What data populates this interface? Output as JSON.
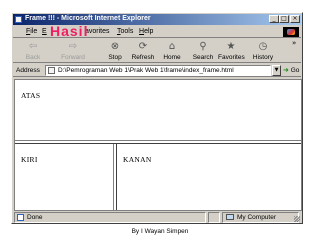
{
  "window": {
    "title": "Frame !!! - Microsoft Internet Explorer",
    "controls": {
      "minimize": "_",
      "maximize": "□",
      "close": "×"
    }
  },
  "watermark": "Hasil",
  "menu": {
    "file": "F",
    "file_rest": "ile",
    "edit": "E",
    "favorites": "avorites",
    "tools": "T",
    "tools_rest": "ools",
    "help": "H",
    "help_rest": "elp"
  },
  "toolbar": {
    "back": {
      "label": "Back",
      "icon": "arrow-left-icon",
      "glyph": "⇦"
    },
    "forward": {
      "label": "Forward",
      "icon": "arrow-right-icon",
      "glyph": "⇨"
    },
    "stop": {
      "label": "Stop",
      "icon": "stop-icon",
      "glyph": "⊗"
    },
    "refresh": {
      "label": "Refresh",
      "icon": "refresh-icon",
      "glyph": "⟳"
    },
    "home": {
      "label": "Home",
      "icon": "home-icon",
      "glyph": "⌂"
    },
    "search": {
      "label": "Search",
      "icon": "search-icon",
      "glyph": "⚲"
    },
    "favorites": {
      "label": "Favorites",
      "icon": "favorites-icon",
      "glyph": "★"
    },
    "history": {
      "label": "History",
      "icon": "history-icon",
      "glyph": "◷"
    },
    "more": "»"
  },
  "address": {
    "label": "Address",
    "value": "D:\\Pemrograman Web 1\\Prak Web 1\\frame\\index_frame.html",
    "dropdown": "▼",
    "go_label": "Go",
    "go_arrow": "➜"
  },
  "frames": {
    "atas": "ATAS",
    "kiri": "KIRI",
    "kanan": "KANAN"
  },
  "status": {
    "text": "Done",
    "zone": "My Computer"
  },
  "caption": "By I Wayan Simpen",
  "colors": {
    "titlebar_start": "#0a246a",
    "titlebar_end": "#a6caf0",
    "chrome": "#d4d0c8",
    "watermark": "#ef1e63"
  }
}
